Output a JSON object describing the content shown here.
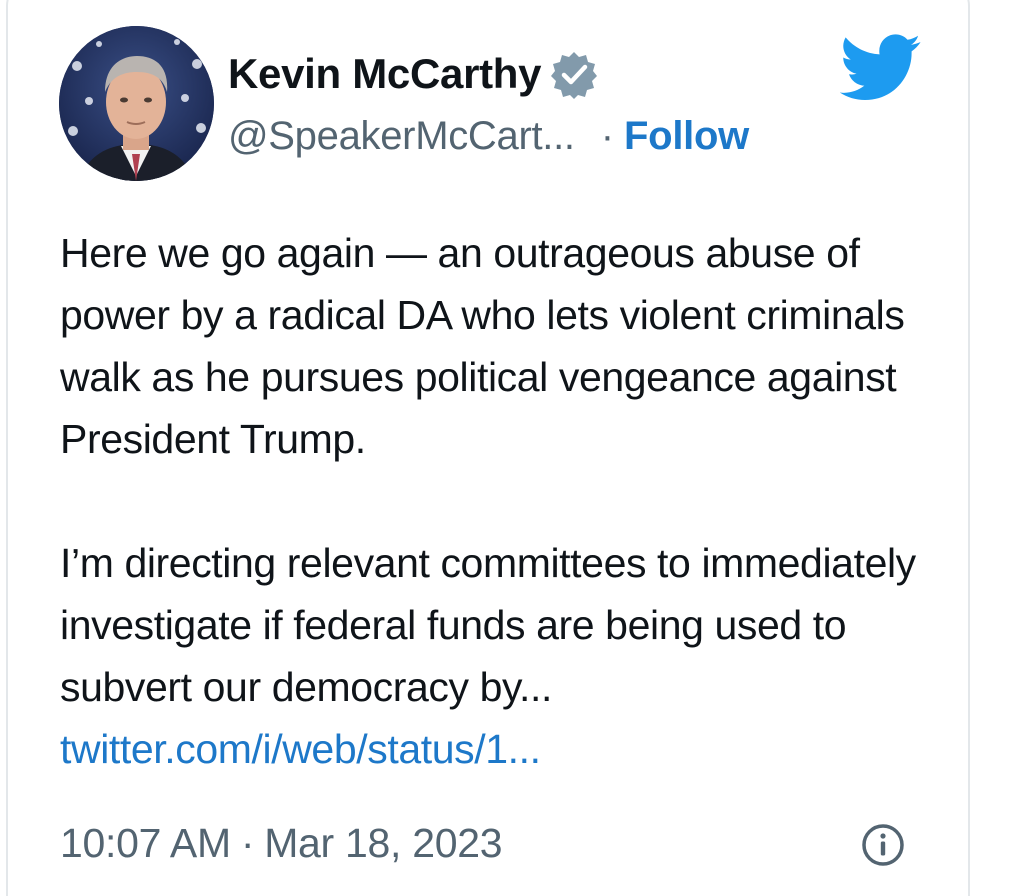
{
  "author": {
    "display_name": "Kevin McCarthy",
    "handle": "@SpeakerMcCart...",
    "separator": "·",
    "follow_label": "Follow",
    "verified_badge_color": "#829aab"
  },
  "brand": {
    "icon": "twitter-bird-icon",
    "color": "#1d9bf0"
  },
  "tweet": {
    "paragraph_1": "Here we go again — an outrageous abuse of power by a radical DA who lets violent criminals walk as he pursues political vengeance against President Trump.",
    "paragraph_2_text": "I’m directing relevant committees to immediately investigate if federal funds are being used to subvert our democracy by...",
    "link_text": "twitter.com/i/web/status/1..."
  },
  "footer": {
    "time": "10:07 AM",
    "separator": "·",
    "date": "Mar 18, 2023",
    "info_icon": "info-icon"
  },
  "colors": {
    "link": "#1d78c9",
    "text": "#0f1419",
    "secondary": "#536471"
  }
}
